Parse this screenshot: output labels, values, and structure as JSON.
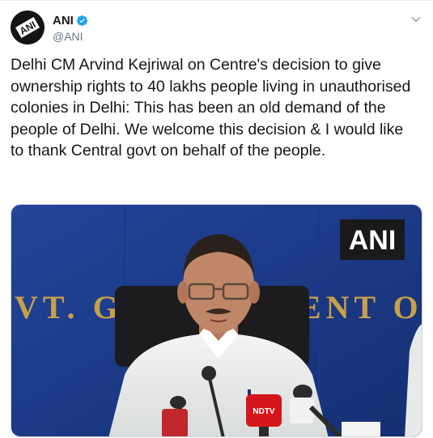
{
  "tweet": {
    "author": {
      "name": "ANI",
      "handle": "@ANI",
      "avatar_text": "ANI",
      "verified": true
    },
    "text": "Delhi CM Arvind Kejriwal on Centre's decision to give ownership rights to 40 lakhs people living in unauthorised colonies in Delhi: This has been an old demand of the people of Delhi. We welcome this decision & I would like to thank Central govt on behalf of the people.",
    "media": {
      "watermark": "ANI",
      "backdrop_text": "VT. GOVERNMENT OF",
      "mic_label": "NDTV"
    }
  },
  "icons": {
    "verified": "verified-badge-icon",
    "more": "chevron-down-icon"
  },
  "colors": {
    "verified_blue": "#1da1f2",
    "backdrop_blue": "#1d3f8c",
    "name_text": "#14171a",
    "handle_text": "#657786"
  }
}
